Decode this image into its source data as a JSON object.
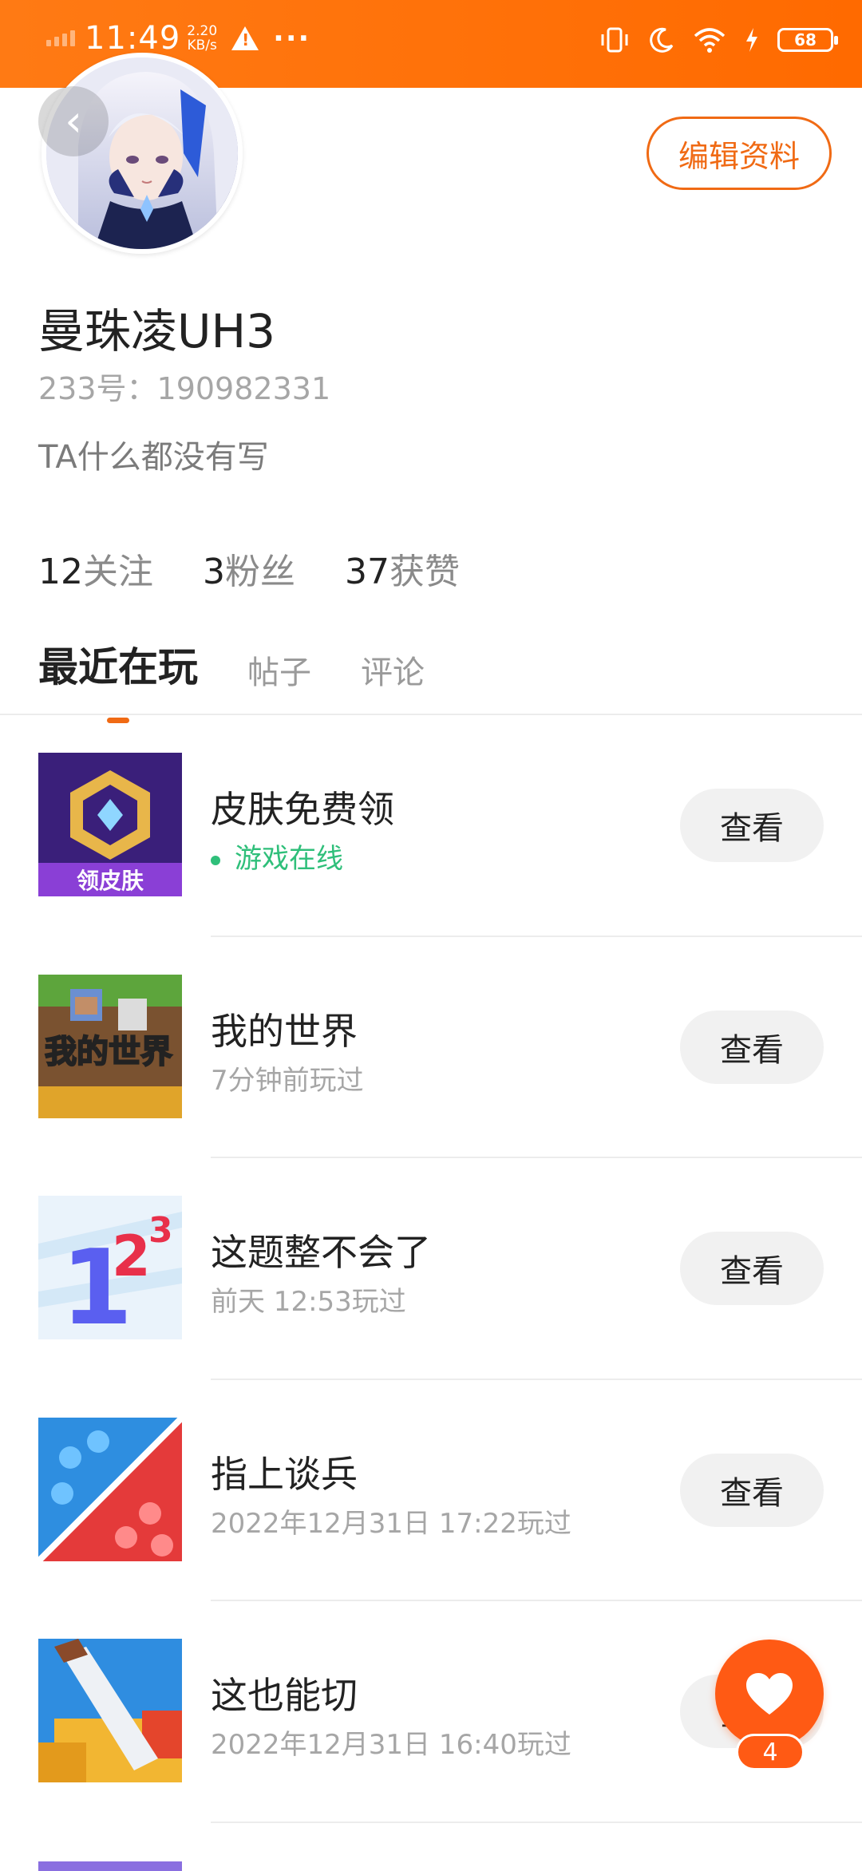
{
  "status_bar": {
    "time": "11:49",
    "net_speed_value": "2.20",
    "net_speed_unit": "KB/s",
    "battery": "68",
    "icons": [
      "signal-icon",
      "warning-icon",
      "more-icon",
      "vibrate-icon",
      "moon-icon",
      "wifi-icon",
      "charging-icon",
      "battery-icon"
    ]
  },
  "header": {
    "back_icon": "back-icon",
    "edit_button": "编辑资料"
  },
  "profile": {
    "username": "曼珠凌UH3",
    "id_line": "233号：190982331",
    "bio": "TA什么都没有写"
  },
  "stats": [
    {
      "count": "12",
      "label": "关注"
    },
    {
      "count": "3",
      "label": "粉丝"
    },
    {
      "count": "37",
      "label": "获赞"
    }
  ],
  "tabs": [
    {
      "label": "最近在玩",
      "active": true
    },
    {
      "label": "帖子",
      "active": false
    },
    {
      "label": "评论",
      "active": false
    }
  ],
  "games": [
    {
      "title": "皮肤免费领",
      "subtitle": "游戏在线",
      "online": true,
      "button": "查看",
      "icon_text": "领皮肤"
    },
    {
      "title": "我的世界",
      "subtitle": "7分钟前玩过",
      "online": false,
      "button": "查看",
      "icon_text": "我的世界"
    },
    {
      "title": "这题整不会了",
      "subtitle": "前天 12:53玩过",
      "online": false,
      "button": "查看",
      "icon_text": "123"
    },
    {
      "title": "指上谈兵",
      "subtitle": "2022年12月31日 17:22玩过",
      "online": false,
      "button": "查看",
      "icon_text": ""
    },
    {
      "title": "这也能切",
      "subtitle": "2022年12月31日 16:40玩过",
      "online": false,
      "button": "查看",
      "icon_text": ""
    }
  ],
  "fab": {
    "icon": "heart-icon",
    "badge": "4"
  },
  "colors": {
    "accent": "#f06a14",
    "status_bar": "#ff7310",
    "online_green": "#2fbf7a",
    "fab": "#ff5a14"
  }
}
